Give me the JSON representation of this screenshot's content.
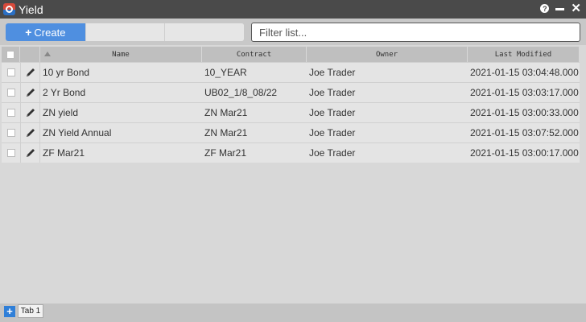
{
  "window": {
    "title": "Yield",
    "app_icon": "app-logo-icon",
    "controls": [
      "help-icon",
      "minimize-icon",
      "close-icon"
    ]
  },
  "toolbar": {
    "create_label": "Create",
    "create_icon": "plus-icon",
    "filter_placeholder": "Filter list..."
  },
  "table": {
    "columns": [
      "Name",
      "Contract",
      "Owner",
      "Last Modified"
    ],
    "sort_column": "Name",
    "rows": [
      {
        "name": "10 yr Bond",
        "contract": "10_YEAR",
        "owner": "Joe Trader",
        "modified": "2021-01-15 03:04:48.000"
      },
      {
        "name": "2 Yr Bond",
        "contract": "UB02_1/8_08/22",
        "owner": "Joe Trader",
        "modified": "2021-01-15 03:03:17.000"
      },
      {
        "name": "ZN yield",
        "contract": "ZN Mar21",
        "owner": "Joe Trader",
        "modified": "2021-01-15 03:00:33.000"
      },
      {
        "name": "ZN Yield Annual",
        "contract": "ZN Mar21",
        "owner": "Joe Trader",
        "modified": "2021-01-15 03:07:52.000"
      },
      {
        "name": "ZF Mar21",
        "contract": "ZF Mar21",
        "owner": "Joe Trader",
        "modified": "2021-01-15 03:00:17.000"
      }
    ]
  },
  "tabs": {
    "items": [
      "Tab 1"
    ],
    "add_icon": "plus-icon"
  },
  "colors": {
    "accent": "#4f8fe0",
    "titlebar": "#4a4a4a"
  }
}
